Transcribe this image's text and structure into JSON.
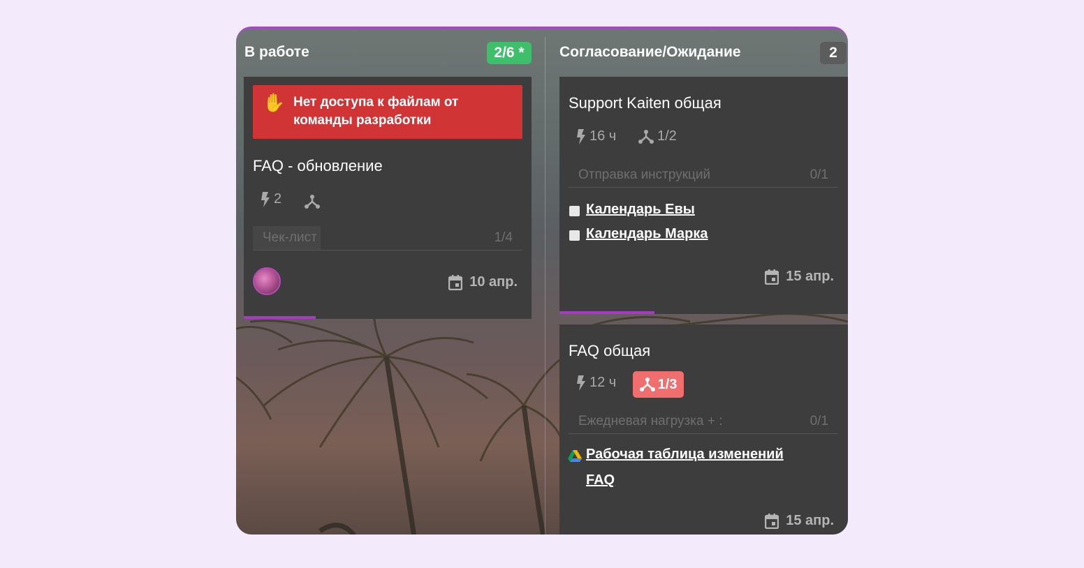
{
  "columns": [
    {
      "title": "В работе",
      "badge": "2/6 *",
      "badge_color": "#3dbf6b",
      "cards": [
        {
          "alert": "Нет доступа к файлам от команды разработки",
          "alert_icon": "raised-hand-icon",
          "title": "FAQ - обновление",
          "size": "2",
          "checklist_label": "Чек-лист",
          "checklist_count": "1/4",
          "checklist_progress": 0.25,
          "due_date": "10 апр.",
          "progress": 0.25
        }
      ]
    },
    {
      "title": "Согласование/Ожидание",
      "badge": "2",
      "badge_color": "#5c5c5c",
      "cards": [
        {
          "title": "Support Kaiten общая",
          "size": "16 ч",
          "subtasks": "1/2",
          "checklist_label": "Отправка инструкций",
          "checklist_count": "0/1",
          "links": [
            "Календарь Евы",
            "Календарь Марка"
          ],
          "due_date": "15 апр.",
          "progress": 0.33
        },
        {
          "title": "FAQ общая",
          "size": "12 ч",
          "subtasks": "1/3",
          "subtasks_color": "#f06e6e",
          "checklist_label": "Ежедневая нагрузка + :",
          "checklist_count": "0/1",
          "link_line1": "Рабочая таблица изменений",
          "link_line2": "FAQ",
          "due_date": "15 апр."
        }
      ]
    }
  ]
}
